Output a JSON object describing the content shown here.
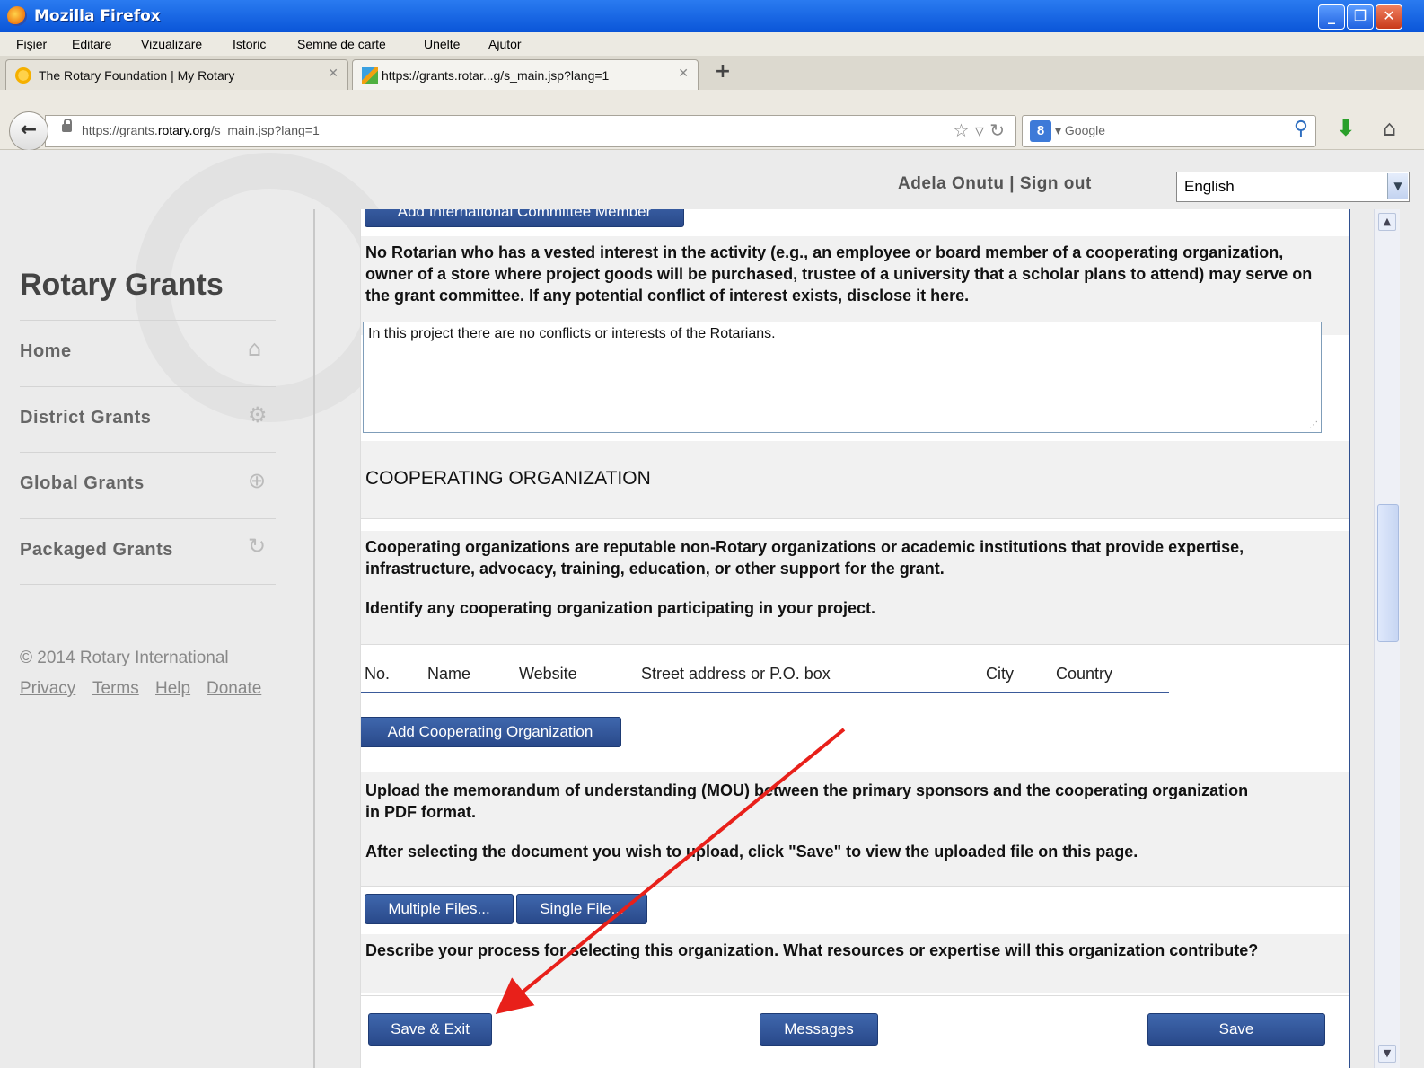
{
  "window": {
    "title": "Mozilla Firefox"
  },
  "menu": [
    "Fișier",
    "Editare",
    "Vizualizare",
    "Istoric",
    "Semne de carte",
    "Unelte",
    "Ajutor"
  ],
  "tabs": [
    {
      "label": "The Rotary Foundation | My Rotary"
    },
    {
      "label": "https://grants.rotar...g/s_main.jsp?lang=1"
    }
  ],
  "address": {
    "prefix": "https://grants.",
    "domain": "rotary.org",
    "path": "/s_main.jsp?lang=1"
  },
  "search": {
    "engine": "Google"
  },
  "header": {
    "user": "Adela Onutu",
    "sep": "|",
    "signout": "Sign out",
    "language": "English"
  },
  "sidebar": {
    "brand": "Rotary Grants",
    "items": [
      {
        "label": "Home",
        "icon": "home-icon"
      },
      {
        "label": "District Grants",
        "icon": "gear-icon"
      },
      {
        "label": "Global Grants",
        "icon": "globe-icon"
      },
      {
        "label": "Packaged Grants",
        "icon": "refresh-icon"
      }
    ],
    "copyright": "© 2014 Rotary International",
    "footer_links": [
      "Privacy",
      "Terms",
      "Help",
      "Donate"
    ]
  },
  "content": {
    "add_committee_btn": "Add International Committee Member",
    "conflict_text": "No Rotarian who has a vested interest in the activity (e.g., an employee or board member of a cooperating organization, owner of a store where project goods will be purchased, trustee of a university that a scholar plans to attend) may serve on the grant committee. If any potential conflict of interest exists, disclose it here.",
    "conflict_answer": "In this project there are no conflicts or interests of the Rotarians.",
    "section_title": "COOPERATING ORGANIZATION",
    "coop_desc": "Cooperating organizations are reputable non-Rotary organizations or academic institutions that provide expertise, infrastructure, advocacy, training, education, or other support for the grant.",
    "coop_identify": "Identify any cooperating organization participating in your project.",
    "table_headers": [
      "No.",
      "Name",
      "Website",
      "Street address or P.O. box",
      "City",
      "Country"
    ],
    "add_coop_btn": "Add Cooperating Organization",
    "mou_text": "Upload the memorandum of understanding (MOU) between the primary sponsors and the cooperating organization in PDF format.",
    "upload_hint": "After selecting the document you wish to upload, click \"Save\" to view the uploaded file on this page.",
    "multiple_files_btn": "Multiple Files...",
    "single_file_btn": "Single File...",
    "process_question": "Describe your process for selecting this organization. What resources or expertise will this organization contribute?"
  },
  "footer": {
    "save_exit": "Save & Exit",
    "messages": "Messages",
    "save": "Save"
  },
  "annotation": {
    "color": "#e8201a"
  }
}
